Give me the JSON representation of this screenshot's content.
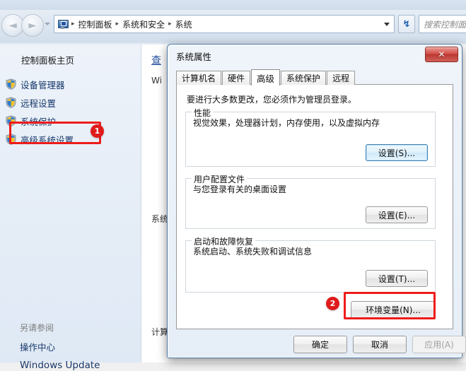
{
  "explorer": {
    "nav": {
      "back_label": "◄",
      "forward_label": "►",
      "back_name": "back-button",
      "forward_name": "forward-button",
      "refresh_label": "↯"
    },
    "address": {
      "icon": "computer-monitor-icon",
      "crumbs": [
        "控制面板",
        "系统和安全",
        "系统"
      ],
      "separator": "▸"
    },
    "search": {
      "placeholder": "搜索控制面板",
      "value": ""
    },
    "sidebar": {
      "home_label": "控制面板主页",
      "items": [
        {
          "label": "设备管理器",
          "icon": "uac-shield-icon"
        },
        {
          "label": "远程设置",
          "icon": "uac-shield-icon"
        },
        {
          "label": "系统保护",
          "icon": "uac-shield-icon"
        },
        {
          "label": "高级系统设置",
          "icon": "uac-shield-icon"
        }
      ],
      "see_also_label": "另请参阅",
      "see_also_items": [
        "操作中心",
        "Windows Update"
      ]
    },
    "content": {
      "title": "查",
      "subtitle": "Wi",
      "section1": "系统",
      "section2": "计算机"
    }
  },
  "dialog": {
    "title": "系统属性",
    "close_label": "✕",
    "tabs": [
      {
        "label": "计算机名",
        "active": false
      },
      {
        "label": "硬件",
        "active": false
      },
      {
        "label": "高级",
        "active": true
      },
      {
        "label": "系统保护",
        "active": false
      },
      {
        "label": "远程",
        "active": false
      }
    ],
    "intro": "要进行大多数更改，您必须作为管理员登录。",
    "groups": [
      {
        "title": "性能",
        "desc": "视觉效果，处理器计划，内存使用，以及虚拟内存",
        "button": "设置(S)..."
      },
      {
        "title": "用户配置文件",
        "desc": "与您登录有关的桌面设置",
        "button": "设置(E)..."
      },
      {
        "title": "启动和故障恢复",
        "desc": "系统启动、系统失败和调试信息",
        "button": "设置(T)..."
      }
    ],
    "env_button": "环境变量(N)...",
    "footer": {
      "ok": "确定",
      "cancel": "取消",
      "apply": "应用(A)"
    }
  },
  "annotations": {
    "badges": [
      {
        "number": "1",
        "target": "高级系统设置"
      },
      {
        "number": "2",
        "target": "环境变量(N)..."
      }
    ],
    "highlight_color": "#ee1b1b"
  }
}
